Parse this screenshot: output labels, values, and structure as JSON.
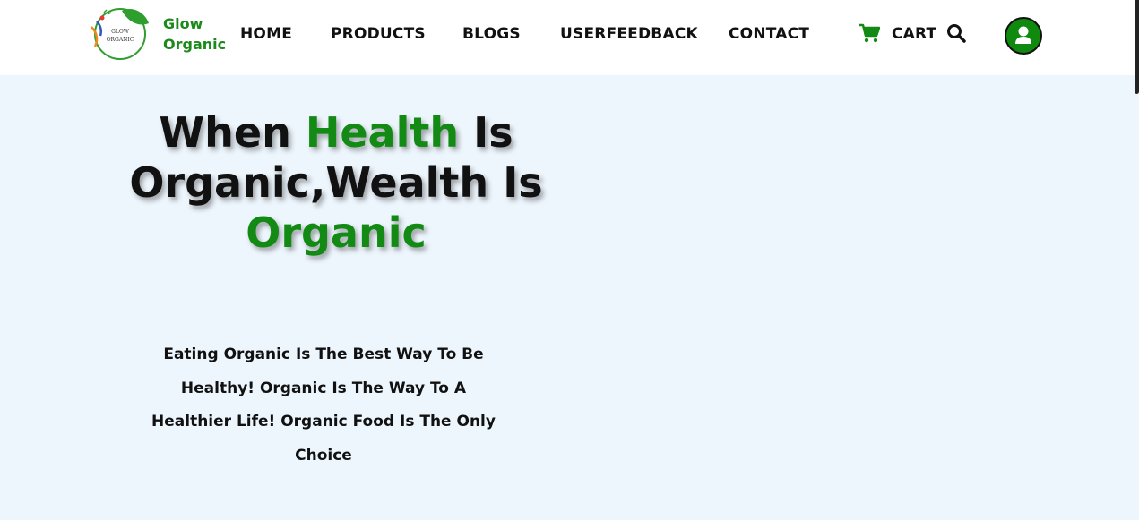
{
  "brand": {
    "line1": "Glow",
    "line2": "Organic",
    "logo_text_1": "GLOW",
    "logo_text_2": "ORGANIC"
  },
  "nav": {
    "home": "HOME",
    "products": "PRODUCTS",
    "blogs": "BLOGS",
    "userfeedback": "USERFEEDBACK",
    "contact": "CONTACT",
    "cart": "CART"
  },
  "icons": {
    "cart": "cart-icon",
    "search": "search-icon",
    "user": "user-icon"
  },
  "colors": {
    "brand_green": "#138a13",
    "background": "#eef6fd",
    "header": "#ffffff"
  },
  "hero": {
    "part1": "When ",
    "part2": "Health",
    "part3": " Is Organic,Wealth Is ",
    "part4": "Organic",
    "subtitle": "Eating Organic Is The Best Way To Be Healthy! Organic Is The Way To A Healthier Life! Organic Food Is The Only Choice"
  }
}
